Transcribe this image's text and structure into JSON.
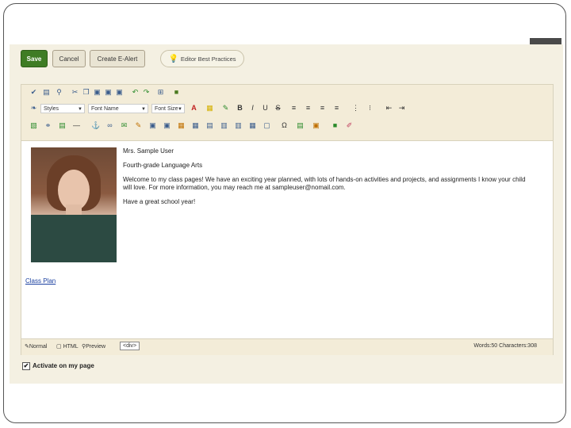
{
  "buttons": {
    "save": "Save",
    "cancel": "Cancel",
    "create_alert": "Create E-Alert",
    "best_practices": "Editor Best Practices"
  },
  "toolbar": {
    "styles_label": "Styles",
    "font_name_label": "Font Name",
    "font_size_label": "Font Size"
  },
  "content": {
    "name": "Mrs. Sample User",
    "subtitle": "Fourth-grade Language Arts",
    "welcome": "Welcome to my class pages! We have an exciting year planned, with lots of hands-on activities and projects, and assignments I know your child will love. For more information, you may reach me at sampleuser@nomail.com.",
    "closing": "Have a great school year!",
    "link": "Class Plan"
  },
  "status": {
    "normal": "Normal",
    "html": "HTML",
    "preview": "Preview",
    "div_tag": "<div>",
    "counts": "Words:50 Characters:308"
  },
  "activate_label": "Activate on my page",
  "colors": {
    "save_green": "#3f7c24",
    "toolbar_bg": "#f3ecd8",
    "link_blue": "#1a3fa0"
  }
}
